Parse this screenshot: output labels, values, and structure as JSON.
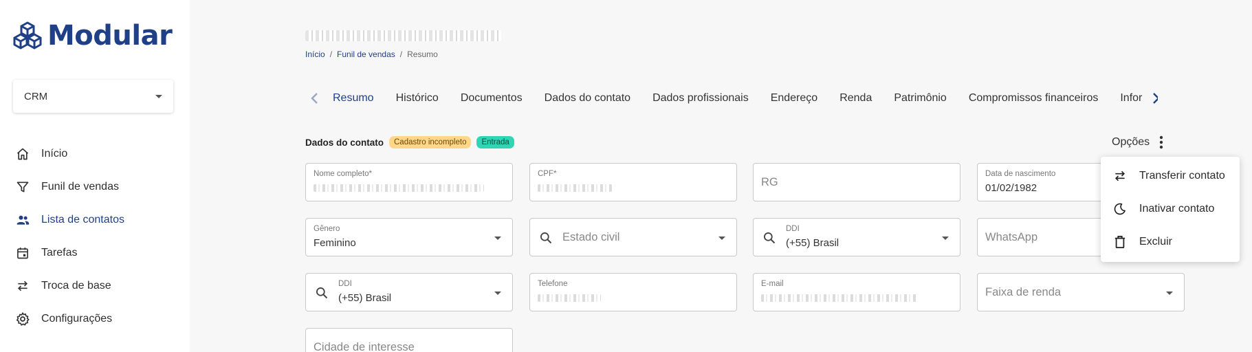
{
  "app": {
    "name": "Modular"
  },
  "sidebar": {
    "module_select": "CRM",
    "items": [
      {
        "label": "Início",
        "icon": "home-icon"
      },
      {
        "label": "Funil de vendas",
        "icon": "filter-icon"
      },
      {
        "label": "Lista de contatos",
        "icon": "people-icon",
        "active": true
      },
      {
        "label": "Tarefas",
        "icon": "calendar-icon"
      },
      {
        "label": "Troca de base",
        "icon": "swap-icon"
      },
      {
        "label": "Configurações",
        "icon": "gear-icon"
      }
    ]
  },
  "breadcrumb": {
    "home": "Início",
    "sep1": "/",
    "funnel": "Funil de vendas",
    "sep2": "/",
    "current": "Resumo"
  },
  "tabs": [
    "Resumo",
    "Histórico",
    "Documentos",
    "Dados do contato",
    "Dados profissionais",
    "Endereço",
    "Renda",
    "Patrimônio",
    "Compromissos financeiros",
    "Infor"
  ],
  "section": {
    "title": "Dados do contato",
    "badge_incomplete": "Cadastro incompleto",
    "badge_stage": "Entrada",
    "options_label": "Opções"
  },
  "fields": {
    "nome_label": "Nome completo*",
    "cpf_label": "CPF*",
    "rg_placeholder": "RG",
    "nascimento_label": "Data de nascimento",
    "nascimento_value": "01/02/1982",
    "genero_label": "Gênero",
    "genero_value": "Feminino",
    "estado_civil_placeholder": "Estado civil",
    "ddi1_label": "DDI",
    "ddi1_value": "(+55) Brasil",
    "whatsapp_placeholder": "WhatsApp",
    "ddi2_label": "DDI",
    "ddi2_value": "(+55) Brasil",
    "telefone_label": "Telefone",
    "email_label": "E-mail",
    "faixa_renda_placeholder": "Faixa de renda",
    "cidade_placeholder": "Cidade de interesse"
  },
  "menu": {
    "transfer": "Transferir contato",
    "inactivate": "Inativar contato",
    "delete": "Excluir"
  },
  "colors": {
    "brand": "#1f3f86",
    "badge_warn": "#ffd68a",
    "badge_ok": "#2fd5b4"
  }
}
